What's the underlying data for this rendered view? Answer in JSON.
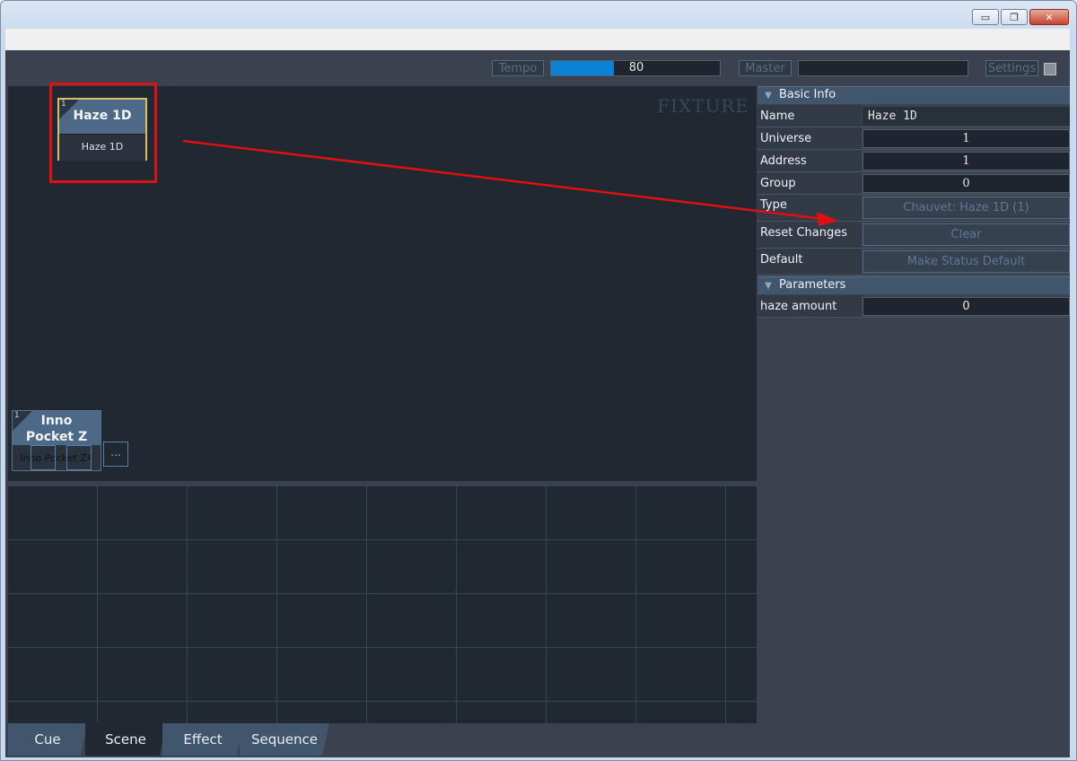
{
  "window": {
    "minimize_icon": "minimize-icon",
    "maximize_icon": "maximize-icon",
    "close_icon": "close-icon",
    "minimize_glyph": "▭",
    "maximize_glyph": "❐",
    "close_glyph": "✕"
  },
  "topbar": {
    "tempo_label": "Tempo",
    "tempo_value": "80",
    "tempo_fraction": 0.37,
    "master_label": "Master",
    "settings_label": "Settings"
  },
  "stage": {
    "label": "FIXTURE",
    "fixtures": [
      {
        "number": "1",
        "name": "Haze 1D",
        "sub": "Haze 1D"
      },
      {
        "number": "1",
        "name": "Inno Pocket Z",
        "sub": "Inno Pocket Z4"
      }
    ],
    "more_label": "..."
  },
  "tabs": [
    "Cue",
    "Scene",
    "Effect",
    "Sequence"
  ],
  "active_tab": "Scene",
  "panel": {
    "basic_info": {
      "title": "Basic Info",
      "name_label": "Name",
      "name_value": "Haze 1D",
      "universe_label": "Universe",
      "universe_value": "1",
      "address_label": "Address",
      "address_value": "1",
      "group_label": "Group",
      "group_value": "0",
      "type_label": "Type",
      "type_value": "Chauvet: Haze 1D (1)",
      "reset_label": "Reset Changes",
      "reset_button": "Clear",
      "default_label": "Default",
      "default_button": "Make Status Default"
    },
    "parameters": {
      "title": "Parameters",
      "haze_label": "haze amount",
      "haze_value": "0"
    }
  },
  "colors": {
    "accent": "#0b82d6",
    "annotation": "#e01010",
    "selected_border": "#d9c063"
  }
}
